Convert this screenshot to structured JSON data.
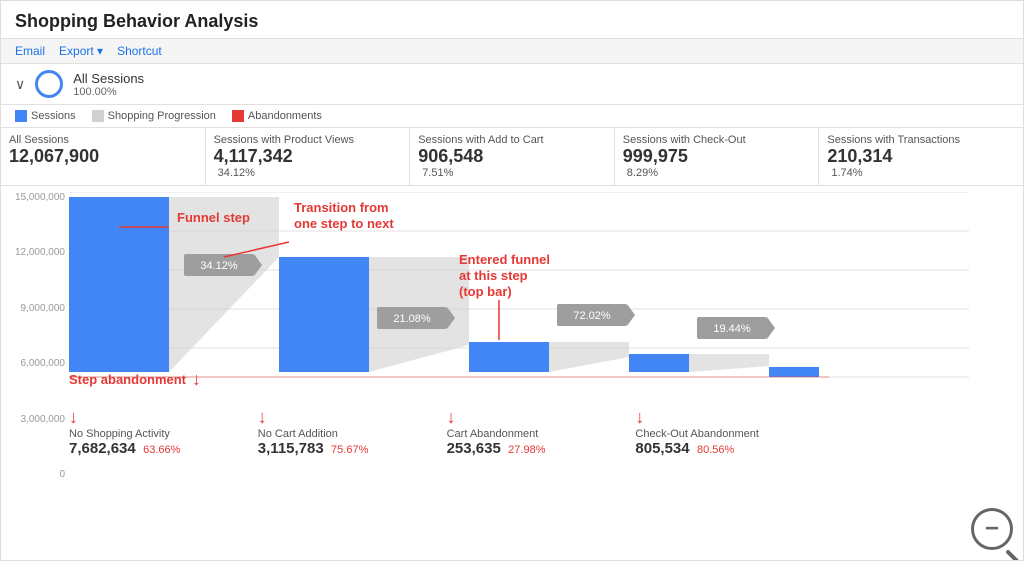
{
  "page": {
    "title": "Shopping Behavior Analysis"
  },
  "toolbar": {
    "email": "Email",
    "export": "Export",
    "shortcut": "Shortcut"
  },
  "segment": {
    "name": "All Sessions",
    "percentage": "100.00%"
  },
  "legend": [
    {
      "id": "sessions",
      "label": "Sessions",
      "color": "#4285f4"
    },
    {
      "id": "progression",
      "label": "Shopping Progression",
      "color": "#d0d0d0"
    },
    {
      "id": "abandonments",
      "label": "Abandonments",
      "color": "#e53935"
    }
  ],
  "metrics": [
    {
      "id": "all-sessions",
      "label": "All Sessions",
      "value": "12,067,900",
      "pct": ""
    },
    {
      "id": "product-views",
      "label": "Sessions with Product Views",
      "value": "4,117,342",
      "pct": "34.12%"
    },
    {
      "id": "add-to-cart",
      "label": "Sessions with Add to Cart",
      "value": "906,548",
      "pct": "7.51%"
    },
    {
      "id": "check-out",
      "label": "Sessions with Check-Out",
      "value": "999,975",
      "pct": "8.29%"
    },
    {
      "id": "transactions",
      "label": "Sessions with Transactions",
      "value": "210,314",
      "pct": "1.74%"
    }
  ],
  "y_axis": [
    "15,000,000",
    "12,000,000",
    "9,000,000",
    "6,000,000",
    "3,000,000",
    "0"
  ],
  "transitions": [
    {
      "id": "t1",
      "pct": "34.12%"
    },
    {
      "id": "t2",
      "pct": "21.08%"
    },
    {
      "id": "t3",
      "pct": "72.02%"
    },
    {
      "id": "t4",
      "pct": "19.44%"
    }
  ],
  "abandonments": [
    {
      "id": "no-shopping",
      "label": "No Shopping Activity",
      "value": "7,682,634",
      "pct": "63.66%"
    },
    {
      "id": "no-cart",
      "label": "No Cart Addition",
      "value": "3,115,783",
      "pct": "75.67%"
    },
    {
      "id": "cart-abandon",
      "label": "Cart Abandonment",
      "value": "253,635",
      "pct": "27.98%"
    },
    {
      "id": "checkout-abandon",
      "label": "Check-Out Abandonment",
      "value": "805,534",
      "pct": "80.56%"
    }
  ],
  "annotations": {
    "funnel_step": "Funnel step",
    "transition": "Transition from\none step to next",
    "entered_funnel": "Entered funnel\nat this step\n(top bar)",
    "abandonment": "Step abandonment"
  },
  "zoom": "−"
}
